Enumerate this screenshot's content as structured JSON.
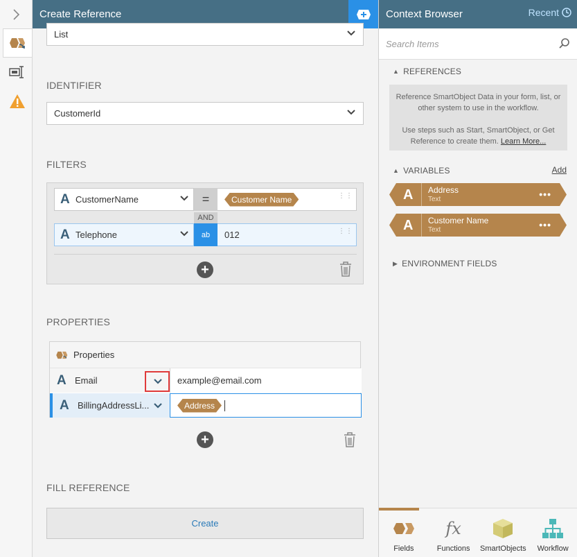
{
  "left_panel": {
    "title": "Create Reference",
    "list_select": "List",
    "identifier_title": "IDENTIFIER",
    "identifier_value": "CustomerId",
    "filters_title": "FILTERS",
    "filters": [
      {
        "field": "CustomerName",
        "operator": "=",
        "value": "Customer Name"
      },
      {
        "field": "Telephone",
        "operator": "ab",
        "value": "012"
      }
    ],
    "and_label": "AND",
    "properties_title": "PROPERTIES",
    "properties_header": "Properties",
    "properties": [
      {
        "name": "Email",
        "value": "example@email.com"
      },
      {
        "name": "BillingAddressLi...",
        "value": "Address"
      }
    ],
    "fill_reference_title": "FILL REFERENCE",
    "create_label": "Create"
  },
  "right_panel": {
    "title": "Context Browser",
    "recent_label": "Recent",
    "search_placeholder": "Search Items",
    "references_title": "REFERENCES",
    "references_info": "Reference SmartObject Data in your form, list, or other system to use in the workflow.",
    "references_info2": "Use steps such as Start, SmartObject, or Get Reference to create them.",
    "learn_more": "Learn More...",
    "variables_title": "VARIABLES",
    "add_label": "Add",
    "variables": [
      {
        "name": "Address",
        "type": "Text"
      },
      {
        "name": "Customer Name",
        "type": "Text"
      }
    ],
    "environment_title": "ENVIRONMENT FIELDS",
    "tabs": [
      {
        "label": "Fields"
      },
      {
        "label": "Functions"
      },
      {
        "label": "SmartObjects"
      },
      {
        "label": "Workflow"
      }
    ]
  },
  "colors": {
    "header": "#466f85",
    "accent_blue": "#2a90e6",
    "chip": "#b5854c",
    "highlight_red": "#e03a3a"
  }
}
